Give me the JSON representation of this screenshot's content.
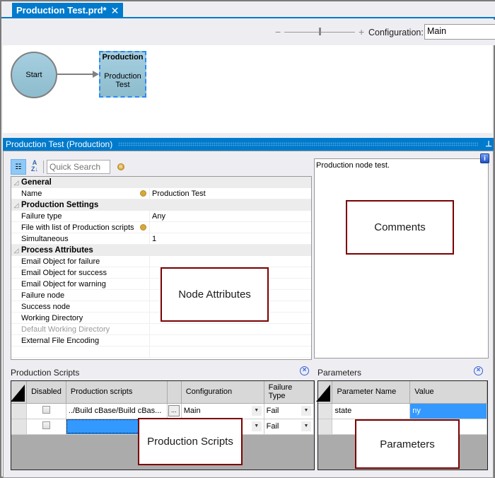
{
  "tab": {
    "title": "Production Test.prd*",
    "close_glyph": "✕"
  },
  "designer_toolbar": {
    "zoom_minus": "−",
    "zoom_plus": "+",
    "zoom_level_fraction": 0.5,
    "configuration_label": "Configuration:",
    "configuration_value": "Main"
  },
  "canvas": {
    "start_node": {
      "label": "Start"
    },
    "production_node": {
      "type_label": "Production",
      "name": "Production Test"
    }
  },
  "properties_panel": {
    "title": "Production Test (Production)",
    "pin_glyph": "⊥",
    "quick_search_placeholder": "Quick Search",
    "sort_alpha_glyph": "A\nZ↓",
    "categories": [
      {
        "name": "General",
        "rows": [
          {
            "name": "Name",
            "value": "Production Test",
            "has_bang": true,
            "disabled": false
          }
        ]
      },
      {
        "name": "Production Settings",
        "rows": [
          {
            "name": "Failure type",
            "value": "Any",
            "has_bang": false,
            "disabled": false
          },
          {
            "name": "File with list of Production scripts",
            "value": "",
            "has_bang": true,
            "disabled": false
          },
          {
            "name": "Simultaneous",
            "value": "1",
            "has_bang": false,
            "disabled": false
          }
        ]
      },
      {
        "name": "Process Attributes",
        "rows": [
          {
            "name": "Email Object for failure",
            "value": "",
            "has_bang": false,
            "disabled": false
          },
          {
            "name": "Email Object for success",
            "value": "",
            "has_bang": false,
            "disabled": false
          },
          {
            "name": "Email Object for warning",
            "value": "",
            "has_bang": false,
            "disabled": false
          },
          {
            "name": "Failure node",
            "value": "",
            "has_bang": false,
            "disabled": false
          },
          {
            "name": "Success node",
            "value": "",
            "has_bang": false,
            "disabled": false
          },
          {
            "name": "Working Directory",
            "value": "",
            "has_bang": false,
            "disabled": false
          },
          {
            "name": "Default Working Directory",
            "value": "",
            "has_bang": false,
            "disabled": true
          },
          {
            "name": "External File Encoding",
            "value": "",
            "has_bang": false,
            "disabled": false
          }
        ]
      }
    ],
    "comments_text": "Production node test.",
    "info_glyph": "i"
  },
  "annotations": {
    "node_attributes": "Node Attributes",
    "comments": "Comments",
    "production_scripts": "Production Scripts",
    "parameters": "Parameters"
  },
  "production_scripts": {
    "title": "Production Scripts",
    "columns": [
      "Disabled",
      "Production scripts",
      "",
      "Configuration",
      "Failure Type"
    ],
    "rows": [
      {
        "disabled": false,
        "script": "../Build cBase/Build cBas...",
        "configuration": "Main",
        "failure_type": "Fail"
      },
      {
        "disabled": false,
        "script": "",
        "configuration": "",
        "failure_type": "Fail"
      }
    ],
    "ellipsis": "..."
  },
  "parameters": {
    "title": "Parameters",
    "columns": [
      "Parameter Name",
      "Value"
    ],
    "rows": [
      {
        "name": "state",
        "value": "ny"
      },
      {
        "name": "",
        "value": ""
      }
    ]
  }
}
